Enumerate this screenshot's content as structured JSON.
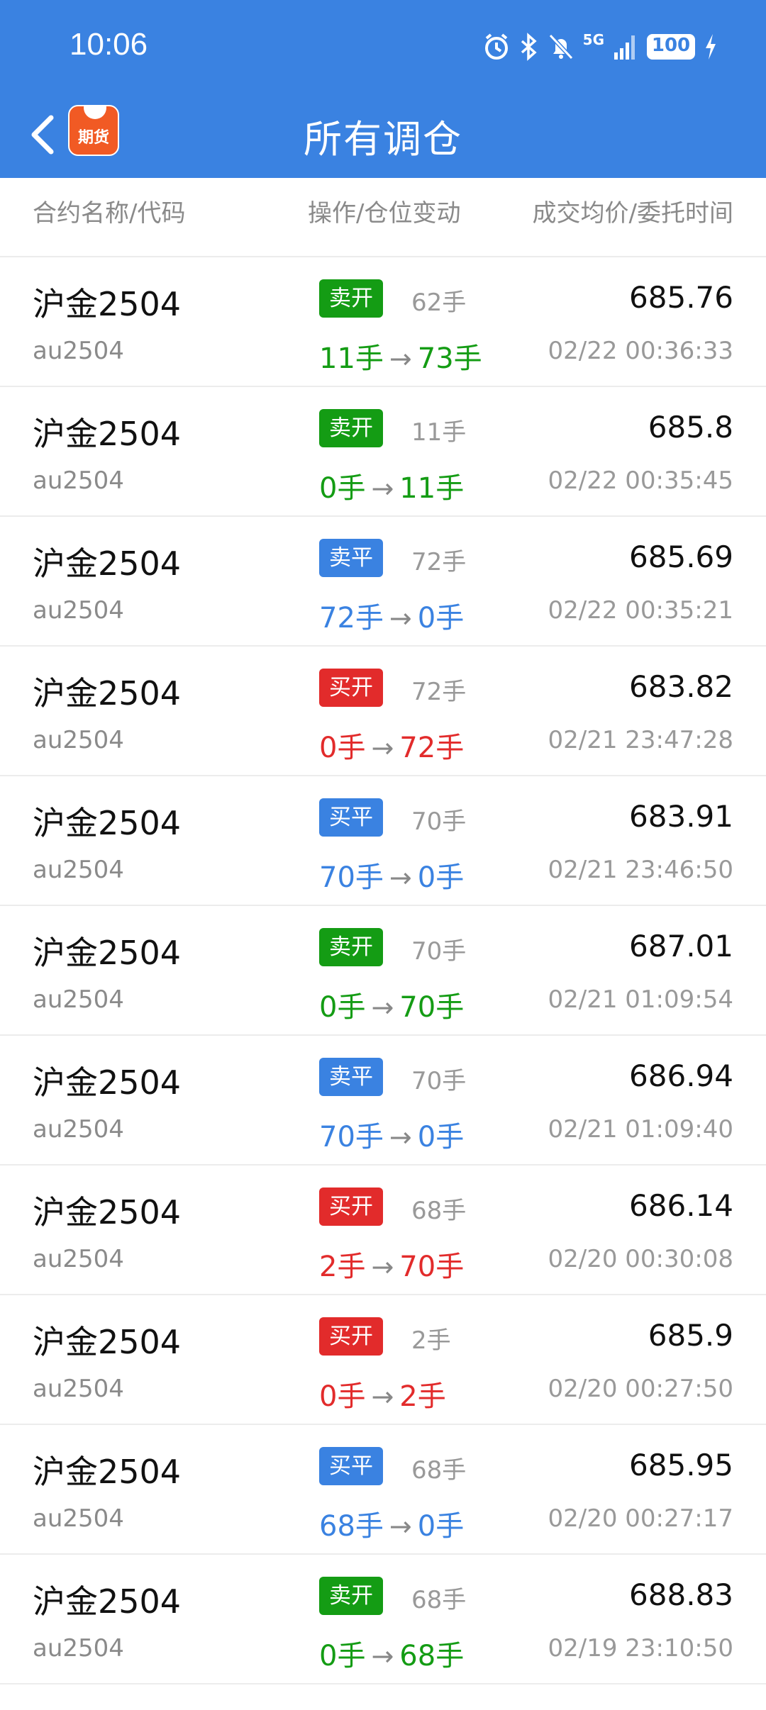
{
  "status_bar": {
    "time": "10:06",
    "network": "5G",
    "battery": "100",
    "icons": [
      "alarm-icon",
      "bluetooth-icon",
      "bell-muted-icon",
      "signal-icon",
      "battery-icon",
      "charging-icon"
    ]
  },
  "nav": {
    "title": "所有调仓",
    "logo_label": "期货",
    "back_icon": "chevron-left-icon"
  },
  "columns": {
    "name": "合约名称/代码",
    "operation": "操作/仓位变动",
    "price_time": "成交均价/委托时间"
  },
  "colors": {
    "header_blue": "#3a82e1",
    "sell_open_green": "#149c14",
    "close_blue": "#3a82e1",
    "buy_open_red": "#e22b2b"
  },
  "rows": [
    {
      "name": "沪金2504",
      "code": "au2504",
      "action": "卖开",
      "type": "sell_open",
      "qty": "62手",
      "from": "11手",
      "to": "73手",
      "price": "685.76",
      "time": "02/22 00:36:33"
    },
    {
      "name": "沪金2504",
      "code": "au2504",
      "action": "卖开",
      "type": "sell_open",
      "qty": "11手",
      "from": "0手",
      "to": "11手",
      "price": "685.8",
      "time": "02/22 00:35:45"
    },
    {
      "name": "沪金2504",
      "code": "au2504",
      "action": "卖平",
      "type": "close",
      "qty": "72手",
      "from": "72手",
      "to": "0手",
      "price": "685.69",
      "time": "02/22 00:35:21"
    },
    {
      "name": "沪金2504",
      "code": "au2504",
      "action": "买开",
      "type": "buy_open",
      "qty": "72手",
      "from": "0手",
      "to": "72手",
      "price": "683.82",
      "time": "02/21 23:47:28"
    },
    {
      "name": "沪金2504",
      "code": "au2504",
      "action": "买平",
      "type": "close",
      "qty": "70手",
      "from": "70手",
      "to": "0手",
      "price": "683.91",
      "time": "02/21 23:46:50"
    },
    {
      "name": "沪金2504",
      "code": "au2504",
      "action": "卖开",
      "type": "sell_open",
      "qty": "70手",
      "from": "0手",
      "to": "70手",
      "price": "687.01",
      "time": "02/21 01:09:54"
    },
    {
      "name": "沪金2504",
      "code": "au2504",
      "action": "卖平",
      "type": "close",
      "qty": "70手",
      "from": "70手",
      "to": "0手",
      "price": "686.94",
      "time": "02/21 01:09:40"
    },
    {
      "name": "沪金2504",
      "code": "au2504",
      "action": "买开",
      "type": "buy_open",
      "qty": "68手",
      "from": "2手",
      "to": "70手",
      "price": "686.14",
      "time": "02/20 00:30:08"
    },
    {
      "name": "沪金2504",
      "code": "au2504",
      "action": "买开",
      "type": "buy_open",
      "qty": "2手",
      "from": "0手",
      "to": "2手",
      "price": "685.9",
      "time": "02/20 00:27:50"
    },
    {
      "name": "沪金2504",
      "code": "au2504",
      "action": "买平",
      "type": "close",
      "qty": "68手",
      "from": "68手",
      "to": "0手",
      "price": "685.95",
      "time": "02/20 00:27:17"
    },
    {
      "name": "沪金2504",
      "code": "au2504",
      "action": "卖开",
      "type": "sell_open",
      "qty": "68手",
      "from": "0手",
      "to": "68手",
      "price": "688.83",
      "time": "02/19 23:10:50"
    }
  ]
}
